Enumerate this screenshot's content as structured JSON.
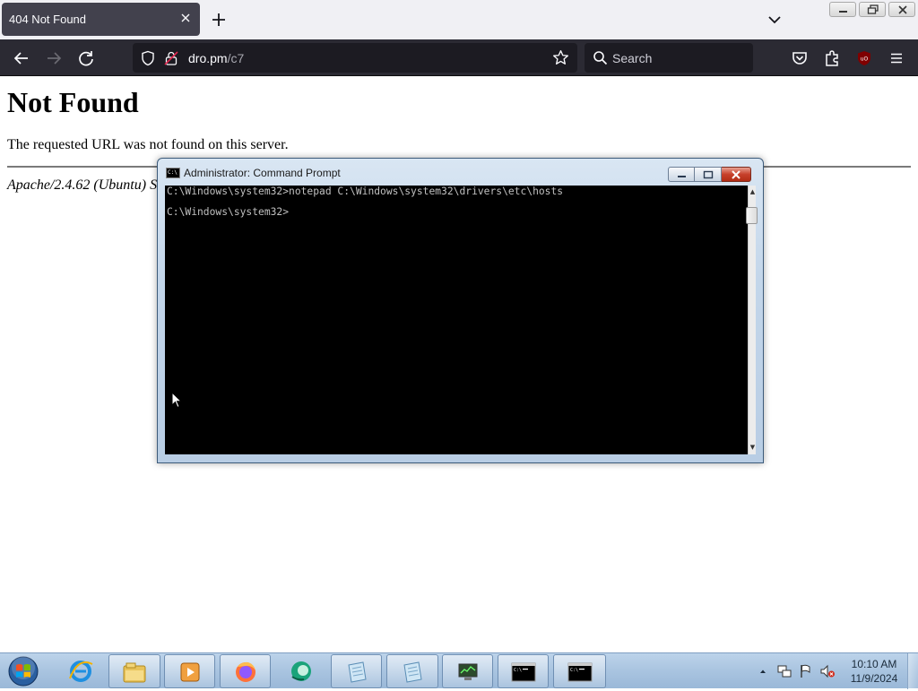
{
  "browser": {
    "tab": {
      "title": "404 Not Found"
    },
    "url": {
      "host": "dro.pm",
      "path": "/c7"
    },
    "search": {
      "placeholder": "Search"
    },
    "colors": {
      "toolbar": "#2b2a33",
      "tabstrip": "#f0f0f4"
    }
  },
  "page": {
    "heading": "Not Found",
    "message": "The requested URL was not found on this server.",
    "server_signature": "Apache/2.4.62 (Ubuntu) S"
  },
  "cmd": {
    "title": "Administrator: Command Prompt",
    "icon_label": "C:\\",
    "lines": [
      "C:\\Windows\\system32>notepad C:\\Windows\\system32\\drivers\\etc\\hosts",
      "C:\\Windows\\system32>"
    ]
  },
  "taskbar": {
    "items": [
      {
        "name": "internet-explorer",
        "icon": "ie-icon"
      },
      {
        "name": "file-explorer",
        "icon": "folder-icon"
      },
      {
        "name": "media-player",
        "icon": "media-player-icon"
      },
      {
        "name": "firefox",
        "icon": "firefox-icon"
      },
      {
        "name": "app-green-circle",
        "icon": "green-circle-icon"
      },
      {
        "name": "notepad-1",
        "icon": "notepad-icon"
      },
      {
        "name": "notepad-2",
        "icon": "notepad-icon"
      },
      {
        "name": "system-monitor",
        "icon": "monitor-icon"
      },
      {
        "name": "cmd-1",
        "icon": "cmd-icon"
      },
      {
        "name": "cmd-2",
        "icon": "cmd-icon"
      }
    ],
    "clock": {
      "time": "10:10 AM",
      "date": "11/9/2024"
    }
  }
}
